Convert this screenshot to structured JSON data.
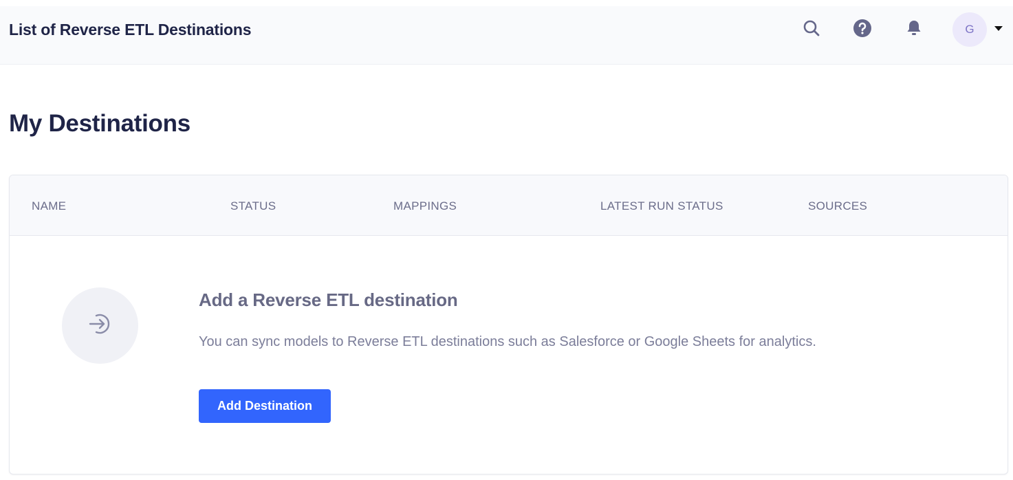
{
  "header": {
    "title": "List of Reverse ETL Destinations",
    "icons": [
      "search-icon",
      "help-icon",
      "bell-icon"
    ],
    "avatar_initial": "G",
    "user_menu_icon": "caret-down-icon"
  },
  "page": {
    "title": "My Destinations"
  },
  "table": {
    "columns": [
      "NAME",
      "STATUS",
      "MAPPINGS",
      "LATEST RUN STATUS",
      "SOURCES"
    ],
    "rows": []
  },
  "empty_state": {
    "icon": "sign-in-arrow-icon",
    "title": "Add a Reverse ETL destination",
    "description": "You can sync models to Reverse ETL destinations such as Salesforce or Google Sheets for analytics.",
    "button_label": "Add Destination"
  },
  "colors": {
    "primary": "#3265fd",
    "heading": "#1f2447",
    "muted_text": "#6b6d8a",
    "avatar_bg": "#ece9fb"
  }
}
